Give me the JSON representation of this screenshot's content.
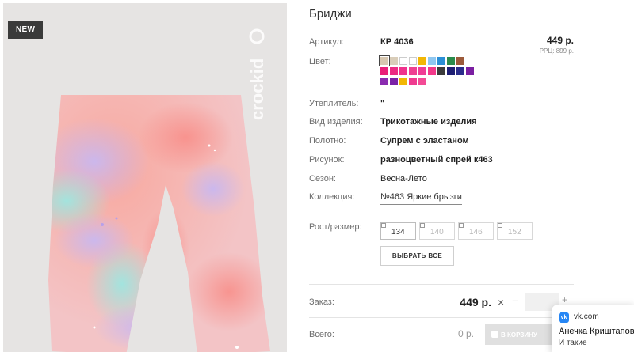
{
  "image": {
    "badge": "NEW",
    "brand_logo_text": "crockid"
  },
  "product": {
    "title": "Бриджи",
    "price": "449 р.",
    "rrc": "РРЦ: 899 р.",
    "fields": [
      {
        "label": "Артикул:",
        "value": "КР 4036"
      },
      {
        "label": "Цвет:"
      },
      {
        "label": "Утеплитель:",
        "value": "\""
      },
      {
        "label": "Вид изделия:",
        "value": "Трикотажные изделия"
      },
      {
        "label": "Полотно:",
        "value": "Супрем с эластаном"
      },
      {
        "label": "Рисунок:",
        "value": "разноцветный спрей к463"
      },
      {
        "label": "Сезон:",
        "value": "Весна-Лето"
      },
      {
        "label": "Коллекция:",
        "value": "№463 Яркие брызги"
      },
      {
        "label": "Рост/размер:"
      }
    ],
    "colors": {
      "row1": [
        "#d7c7b0",
        "#d9cdb9",
        "#ffffff",
        "#ffffff",
        "#f2b705",
        "#8fc7f0",
        "#2b8fd6",
        "#2a8b4b",
        "#9c5a3a"
      ],
      "row2": [
        "#e91e78",
        "#ec2a82",
        "#f0338d",
        "#ef3f92",
        "#f03c95",
        "#f2388a",
        "#3b3b3b",
        "#1d1e73",
        "#2a2c8a",
        "#7b1fa2"
      ],
      "row3": [
        "#8a2bb0",
        "#7a22a6",
        "#f2b705",
        "#ef3b8f",
        "#f34a95"
      ],
      "selected_index": 0
    },
    "sizes": [
      {
        "label": "134",
        "available": true
      },
      {
        "label": "140",
        "available": false
      },
      {
        "label": "146",
        "available": false
      },
      {
        "label": "152",
        "available": false
      }
    ],
    "select_all_label": "ВЫБРАТЬ ВСЕ"
  },
  "order": {
    "label": "Заказ:",
    "price": "449 р.",
    "times": "×",
    "minus": "−",
    "plus": "+",
    "quantity": ""
  },
  "total": {
    "label": "Всего:",
    "value": "0 р.",
    "cart_label": "В КОРЗИНУ"
  },
  "notification": {
    "icon": "vk-icon",
    "source": "vk.com",
    "name": "Анечка Криштапович",
    "message": "И такие"
  }
}
